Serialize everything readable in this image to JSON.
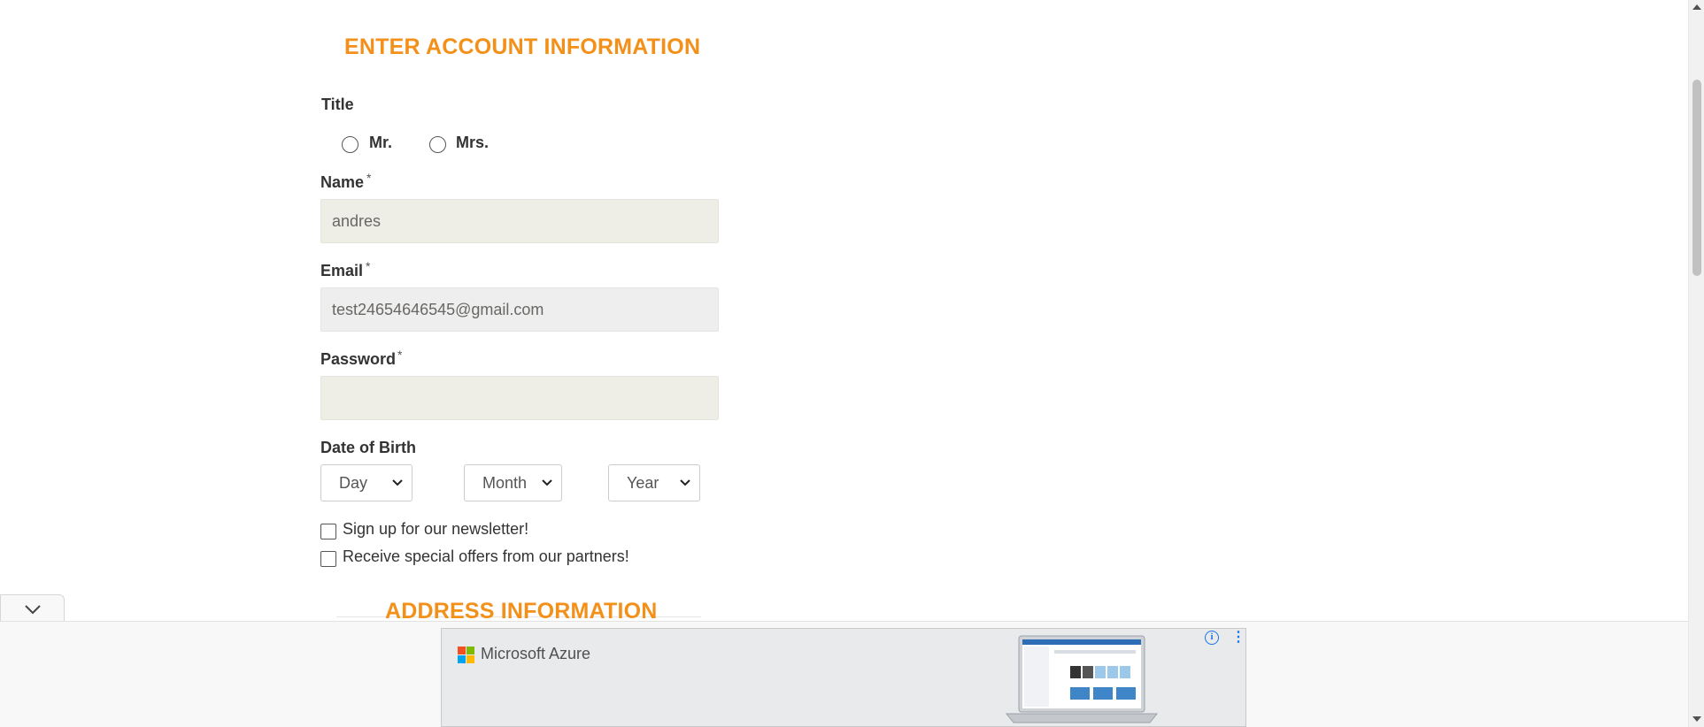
{
  "form": {
    "account_heading": "Enter Account Information",
    "title_label": "Title",
    "title_options": [
      "Mr.",
      "Mrs."
    ],
    "name_label": "Name",
    "name_value": "andres",
    "email_label": "Email",
    "email_value": "test24654646545@gmail.com",
    "password_label": "Password",
    "password_value": "",
    "required_marker": "*",
    "dob_label": "Date of Birth",
    "dob_day": "Day",
    "dob_month": "Month",
    "dob_year": "Year",
    "newsletter_label": "Sign up for our newsletter!",
    "offers_label": "Receive special offers from our partners!",
    "address_heading": "Address Information"
  },
  "ad": {
    "brand": "Microsoft Azure",
    "info_icon": "info-icon",
    "more_icon": "more-vertical-icon"
  },
  "colors": {
    "accent": "#f39019",
    "input_bg": "#eeeee6",
    "ad_info": "#1a73e8"
  }
}
